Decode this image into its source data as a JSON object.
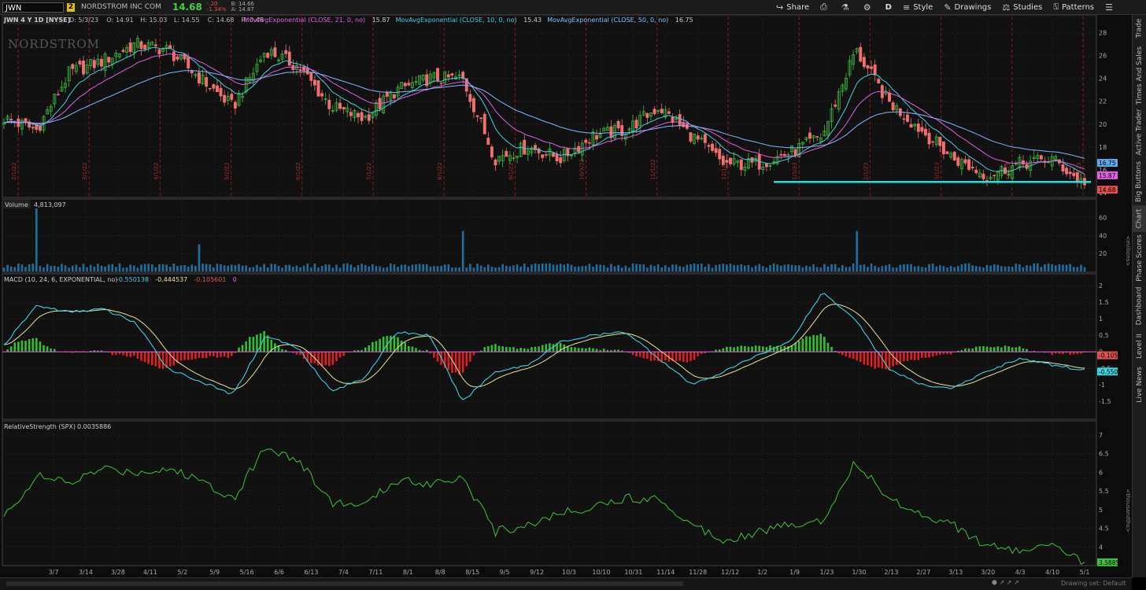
{
  "toolbar": {
    "symbol": "JWN",
    "link_badge": "2",
    "company": "NORDSTROM INC COM",
    "last": "14.68",
    "change": "-.20",
    "change_pct": "-1.34%",
    "bid": "B: 14.66",
    "ask": "A: 14.87",
    "share_label": "Share",
    "period_label": "D",
    "style_label": "Style",
    "drawings_label": "Drawings",
    "studies_label": "Studies",
    "patterns_label": "Patterns"
  },
  "sidebar": {
    "tabs": [
      "Trade",
      "Times And Sales",
      "Active Trader",
      "Big Buttons",
      "Chart",
      "Phase Scores",
      "Dashboard",
      "Level II",
      "Live News"
    ]
  },
  "price_panel": {
    "header": "JWN 4 Y 1D [NYSE]",
    "ohlc": [
      "D: 5/3/23",
      "O: 14.91",
      "H: 15.03",
      "L: 14.55",
      "C: 14.68",
      "R: 0.48"
    ],
    "studies": [
      {
        "label": "MovAvgExponential (CLOSE, 21, 0, no)",
        "value": "15.87",
        "color": "#e060e0"
      },
      {
        "label": "MovAvgExponential (CLOSE, 10, 0, no)",
        "value": "15.43",
        "color": "#40d0e0"
      },
      {
        "label": "MovAvgExponential (CLOSE, 50, 0, no)",
        "value": "16.75",
        "color": "#80c0ff"
      }
    ],
    "watermark": "NORDSTROM",
    "yticks": [
      "28",
      "26",
      "24",
      "22",
      "20",
      "18",
      "16",
      "14"
    ],
    "markers": [
      {
        "text": "16.75",
        "color": "#60a8e8"
      },
      {
        "text": "15.87",
        "color": "#e060e0"
      },
      {
        "text": "14.68",
        "color": "#e05050"
      }
    ],
    "date_notes": [
      "2/1/22",
      "3/1/22",
      "4/1/22",
      "5/2/22",
      "6/1/22",
      "7/1/22",
      "8/1/22",
      "9/1/22",
      "10/3/22",
      "11/1/22",
      "12/1/22",
      "1/3/23",
      "2/1/23",
      "3/1/23",
      "4/3/23",
      "5/1/23"
    ],
    "support_line_color": "#20e0e0"
  },
  "volume_panel": {
    "label": "Volume",
    "value": "4,813,097",
    "yticks": [
      "60",
      "40",
      "20"
    ],
    "unit": "<millions>"
  },
  "macd_panel": {
    "label": "MACD (10, 24, 6, EXPONENTIAL, no)",
    "values": [
      "-0.550138",
      "-0.444537",
      "-0.105601",
      "0"
    ],
    "value_colors": [
      "#40d0e0",
      "#e8e0a0",
      "#e05050",
      "#e060e0"
    ],
    "yticks": [
      "2",
      "1.5",
      "1",
      "0.5",
      "0",
      "-0.5",
      "-1",
      "-1.5"
    ],
    "markers": [
      {
        "text": "-0.1056",
        "color": "#e05050"
      },
      {
        "text": "-0.5501",
        "color": "#40d0e0"
      }
    ]
  },
  "rs_panel": {
    "label": "RelativeStrength (SPX)",
    "value": "0.0035886",
    "yticks": [
      "7",
      "6.5",
      "6",
      "5.5",
      "5",
      "4.5",
      "4"
    ],
    "unit": "<thousandths>",
    "marker": {
      "text": "3.58858",
      "color": "#40c040"
    }
  },
  "x_axis": {
    "labels": [
      "3/7",
      "3/14",
      "3/28",
      "4/11",
      "5/2",
      "5/9",
      "5/16",
      "6/6",
      "6/13",
      "7/4",
      "7/11",
      "8/1",
      "8/8",
      "8/15",
      "9/5",
      "9/12",
      "10/3",
      "10/10",
      "10/31",
      "11/14",
      "11/28",
      "12/12",
      "1/2",
      "1/9",
      "1/23",
      "1/30",
      "2/13",
      "2/27",
      "3/13",
      "3/20",
      "4/3",
      "4/10",
      "5/1"
    ]
  },
  "status": {
    "drawing_set": "Drawing set: Default"
  },
  "chart_data": {
    "type": "candlestick",
    "title": "JWN 4 Y 1D [NYSE]",
    "x": [
      "2/28/22",
      "3/7/22",
      "3/14/22",
      "3/28/22",
      "4/11/22",
      "5/2/22",
      "5/9/22",
      "5/16/22",
      "6/6/22",
      "6/13/22",
      "7/4/22",
      "7/11/22",
      "8/1/22",
      "8/8/22",
      "8/15/22",
      "9/5/22",
      "9/12/22",
      "10/3/22",
      "10/10/22",
      "10/31/22",
      "11/14/22",
      "11/28/22",
      "12/12/22",
      "1/2/23",
      "1/9/23",
      "1/23/23",
      "1/30/23",
      "2/13/23",
      "2/27/23",
      "3/13/23",
      "3/20/23",
      "4/3/23",
      "4/10/23",
      "5/1/23"
    ],
    "close": [
      20.5,
      19.5,
      24.5,
      25.5,
      27.0,
      26.5,
      24.0,
      21.5,
      26.5,
      25.0,
      21.5,
      20.5,
      23.0,
      24.0,
      24.0,
      17.0,
      18.0,
      17.0,
      19.0,
      19.5,
      21.5,
      19.0,
      16.5,
      16.5,
      17.5,
      19.0,
      26.5,
      22.0,
      19.5,
      17.0,
      15.5,
      16.5,
      17.0,
      14.68
    ],
    "ema21_last": 15.87,
    "ema10_last": 15.43,
    "ema50_last": 16.75,
    "ylim": [
      14,
      29
    ],
    "volume_millions": [
      8,
      70,
      12,
      8,
      10,
      9,
      30,
      8,
      10,
      8,
      7,
      6,
      7,
      8,
      45,
      8,
      7,
      6,
      6,
      10,
      8,
      7,
      6,
      7,
      8,
      9,
      45,
      9,
      7,
      7,
      6,
      7,
      6,
      4.8
    ],
    "volume_ylim": [
      0,
      70
    ],
    "macd": [
      0.2,
      1.4,
      1.2,
      1.3,
      0.9,
      -0.5,
      -0.9,
      -1.3,
      0.5,
      0.1,
      -1.2,
      -0.8,
      0.6,
      0.5,
      -1.5,
      -0.6,
      -0.4,
      0.3,
      0.5,
      0.6,
      -0.2,
      -1.0,
      -0.6,
      -0.1,
      0.3,
      1.8,
      1.0,
      -0.5,
      -1.0,
      -1.1,
      -0.6,
      -0.2,
      -0.4,
      -0.55
    ],
    "macd_ylim": [
      -1.9,
      2.1
    ],
    "relative_strength_thousandths": [
      4.8,
      5.9,
      5.7,
      6.1,
      6.0,
      6.1,
      5.8,
      5.3,
      6.7,
      6.3,
      5.2,
      5.1,
      5.8,
      5.7,
      5.9,
      4.4,
      4.6,
      4.9,
      5.1,
      5.3,
      5.3,
      4.6,
      4.2,
      4.4,
      4.6,
      4.7,
      6.3,
      5.3,
      4.9,
      4.6,
      4.0,
      3.9,
      4.0,
      3.59
    ],
    "rs_ylim": [
      3.5,
      7
    ]
  }
}
